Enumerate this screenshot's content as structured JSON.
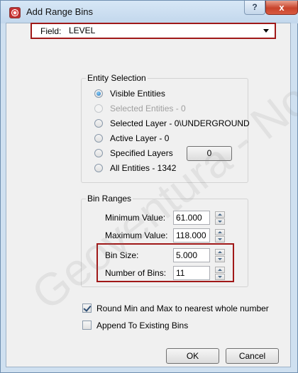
{
  "window": {
    "title": "Add Range Bins",
    "help_label": "?",
    "close_label": "x"
  },
  "field": {
    "label": "Field:",
    "value": "LEVEL"
  },
  "entity_selection": {
    "title": "Entity Selection",
    "options": [
      {
        "label": "Visible Entities",
        "checked": true,
        "enabled": true
      },
      {
        "label": "Selected Entities - 0",
        "checked": false,
        "enabled": false
      },
      {
        "label": "Selected Layer - 0\\UNDERGROUND",
        "checked": false,
        "enabled": true
      },
      {
        "label": "Active Layer - 0",
        "checked": false,
        "enabled": true
      },
      {
        "label": "Specified Layers",
        "checked": false,
        "enabled": true
      },
      {
        "label": "All Entities - 1342",
        "checked": false,
        "enabled": true
      }
    ],
    "specified_layers_button": "0"
  },
  "bin_ranges": {
    "title": "Bin Ranges",
    "min_label": "Minimum Value:",
    "min_value": "61.000",
    "max_label": "Maximum Value:",
    "max_value": "118.000",
    "size_label": "Bin Size:",
    "size_value": "5.000",
    "count_label": "Number of Bins:",
    "count_value": "11"
  },
  "options": {
    "round_label": "Round Min and Max to nearest whole number",
    "round_checked": true,
    "append_label": "Append To Existing Bins",
    "append_checked": false
  },
  "buttons": {
    "ok": "OK",
    "cancel": "Cancel"
  },
  "watermark": "Geoventura - No"
}
